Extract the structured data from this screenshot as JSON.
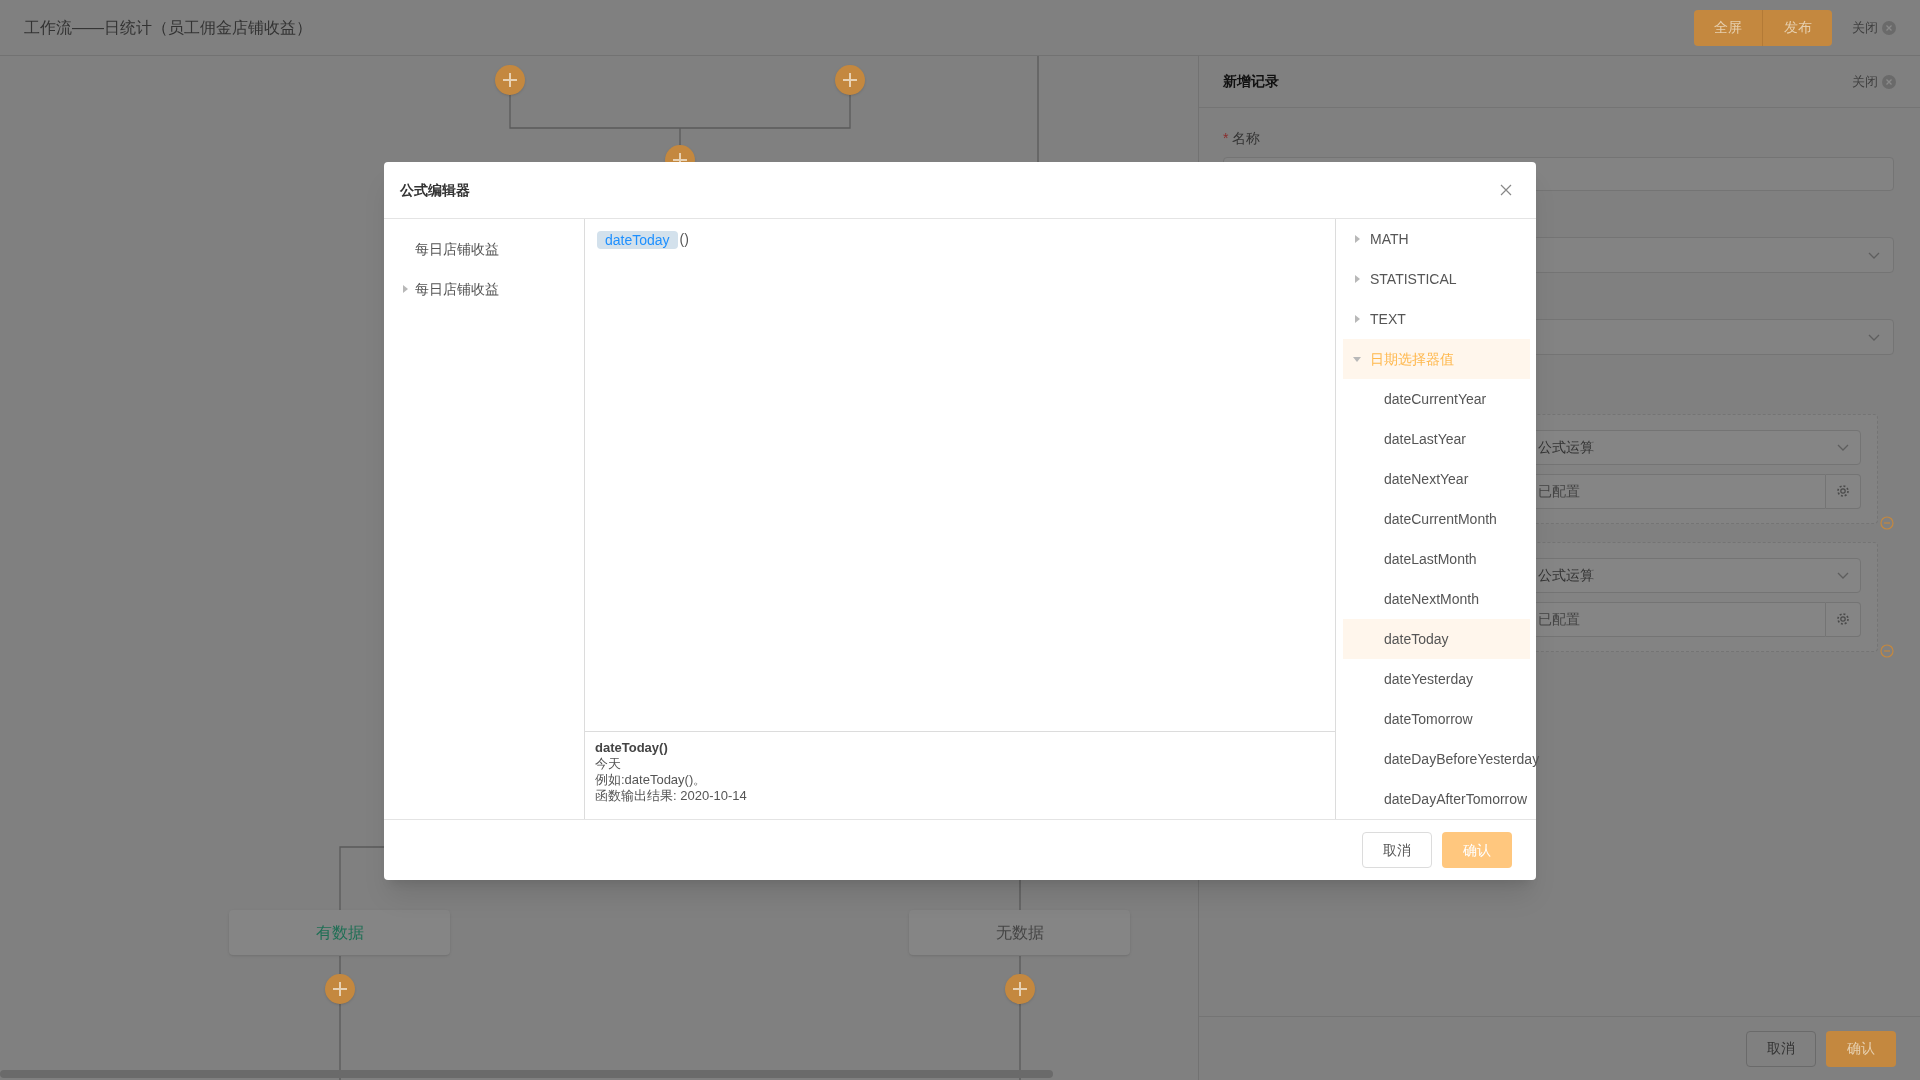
{
  "header": {
    "title": "工作流——日统计（员工佣金店铺收益）",
    "buttons": [
      "全屏",
      "发布"
    ],
    "close": "关闭"
  },
  "canvas": {
    "nodes": [
      {
        "label": "有数据",
        "kind": "active"
      },
      {
        "label": "无数据",
        "kind": "inactive"
      }
    ]
  },
  "panel": {
    "title": "新增记录",
    "close": "关闭",
    "required_mark": "*",
    "name_label": "名称",
    "rules": [
      {
        "type": "公式运算",
        "value": "已配置"
      },
      {
        "type": "公式运算",
        "value": "已配置"
      }
    ],
    "buttons": [
      "取消",
      "确认"
    ]
  },
  "modal": {
    "title": "公式编辑器",
    "fields": [
      {
        "label": "每日店铺收益",
        "expandable": false
      },
      {
        "label": "每日店铺收益",
        "expandable": true
      }
    ],
    "formula": {
      "token": "dateToday",
      "rest": "()"
    },
    "help": {
      "title": "dateToday()",
      "lines": [
        "今天",
        "例如:dateToday()。",
        "函数输出结果: 2020-10-14"
      ]
    },
    "categories": [
      {
        "label": "MATH",
        "expanded": false
      },
      {
        "label": "STATISTICAL",
        "expanded": false
      },
      {
        "label": "TEXT",
        "expanded": false
      },
      {
        "label": "日期选择器值",
        "expanded": true,
        "children": [
          {
            "label": "dateCurrentYear",
            "selected": false
          },
          {
            "label": "dateLastYear",
            "selected": false
          },
          {
            "label": "dateNextYear",
            "selected": false
          },
          {
            "label": "dateCurrentMonth",
            "selected": false
          },
          {
            "label": "dateLastMonth",
            "selected": false
          },
          {
            "label": "dateNextMonth",
            "selected": false
          },
          {
            "label": "dateToday",
            "selected": true
          },
          {
            "label": "dateYesterday",
            "selected": false
          },
          {
            "label": "dateTomorrow",
            "selected": false
          },
          {
            "label": "dateDayBeforeYesterday",
            "selected": false
          },
          {
            "label": "dateDayAfterTomorrow",
            "selected": false
          }
        ]
      }
    ],
    "buttons": [
      {
        "label": "取消",
        "kind": "default"
      },
      {
        "label": "确认",
        "kind": "primary"
      }
    ]
  }
}
